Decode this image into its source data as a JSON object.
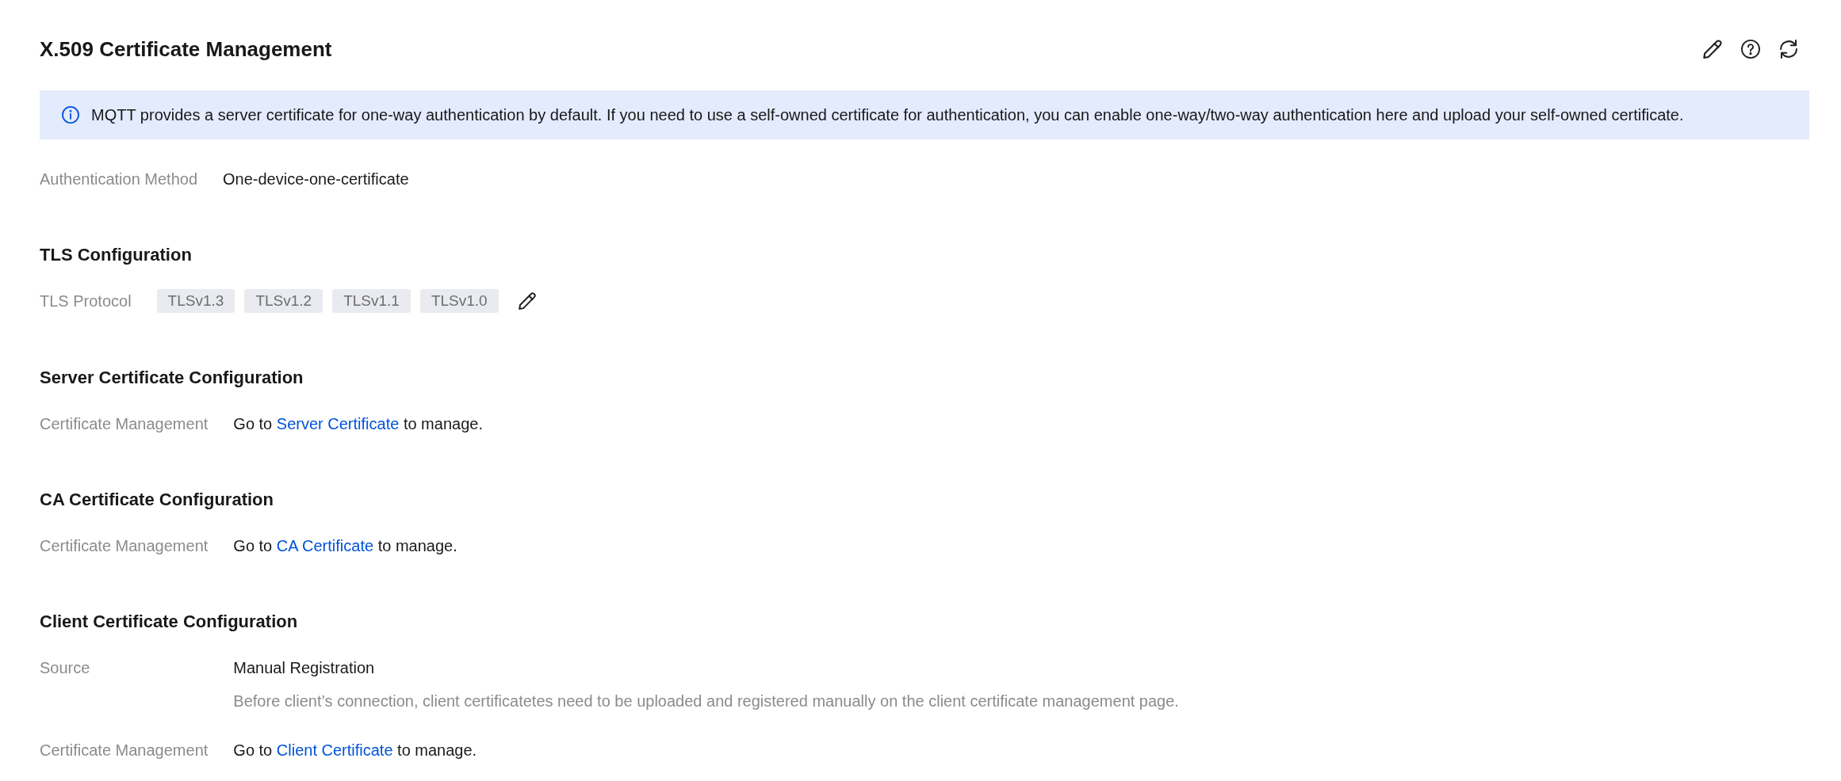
{
  "header": {
    "title": "X.509 Certificate Management"
  },
  "notice": {
    "text": "MQTT provides a server certificate for one-way authentication by default. If you need to use a self-owned certificate for authentication, you can enable one-way/two-way authentication here and upload your self-owned certificate."
  },
  "sections": [
    {
      "fields": [
        {
          "kind": "text",
          "label": "Authentication Method",
          "value": "One-device-one-certificate"
        }
      ]
    },
    {
      "title": "TLS Configuration",
      "fields": [
        {
          "kind": "tags",
          "label": "TLS Protocol",
          "tags": [
            "TLSv1.3",
            "TLSv1.2",
            "TLSv1.1",
            "TLSv1.0"
          ]
        }
      ]
    },
    {
      "title": "Server Certificate Configuration",
      "fields": [
        {
          "kind": "link",
          "label": "Certificate Management",
          "before": "Go to",
          "link": "Server Certificate",
          "after": "to manage."
        }
      ]
    },
    {
      "title": "CA Certificate Configuration",
      "fields": [
        {
          "kind": "link",
          "label": "Certificate Management",
          "before": "Go to",
          "link": "CA Certificate",
          "after": "to manage."
        }
      ]
    },
    {
      "title": "Client Certificate Configuration",
      "fields": [
        {
          "kind": "text",
          "label": "Source",
          "value": "Manual Registration",
          "hint": "Before client’s connection, client certificatetes need to be uploaded and registered manually on the client certificate management page."
        },
        {
          "kind": "link",
          "label": "Certificate Management",
          "before": "Go to",
          "link": "Client Certificate",
          "after": "to manage."
        }
      ]
    }
  ]
}
